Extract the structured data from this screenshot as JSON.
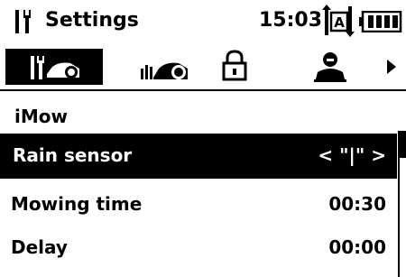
{
  "header": {
    "title": "Settings",
    "time": "15:03",
    "settings_icon": "settings-tools-icon",
    "mode_icon": "automatic-mode-icon",
    "battery_icon": "battery-full-icon"
  },
  "tabs": [
    {
      "icon": "tools-settings-icon",
      "active": true
    },
    {
      "icon": "mower-icon",
      "active": false
    },
    {
      "icon": "lock-icon",
      "active": false
    },
    {
      "icon": "user-icon",
      "active": false
    }
  ],
  "tabs_more_icon": "arrow-right-icon",
  "menu": {
    "title": "iMow",
    "items": [
      {
        "label": "Rain sensor",
        "value": "< \"|\" >",
        "selected": true
      },
      {
        "label": "Mowing time",
        "value": "00:30",
        "selected": false
      },
      {
        "label": "Delay",
        "value": "00:00",
        "selected": false
      }
    ]
  },
  "colors": {
    "background": "#ffffff",
    "foreground": "#000000"
  }
}
